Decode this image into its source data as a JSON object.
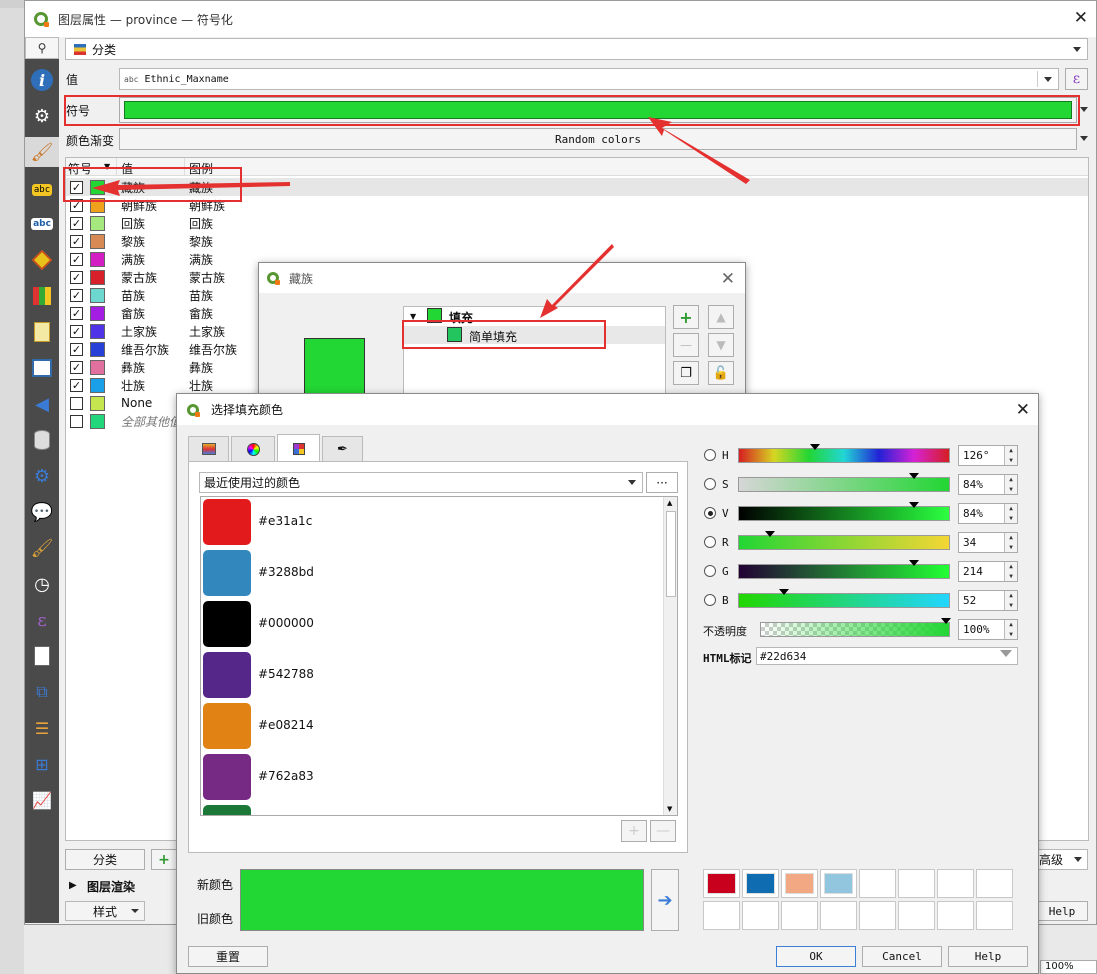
{
  "main": {
    "title": "图层属性 — province — 符号化",
    "renderer": "分类",
    "value_label": "值",
    "value_field_type": "abc",
    "value_field": "Ethnic_Maxname",
    "symbol_label": "符号",
    "ramp_label": "颜色渐变",
    "ramp_value": "Random colors",
    "headers": [
      "符号",
      "值",
      "图例"
    ],
    "rows": [
      {
        "checked": true,
        "color": "#22d634",
        "value": "藏族",
        "legend": "藏族"
      },
      {
        "checked": true,
        "color": "#f0a21c",
        "value": "朝鲜族",
        "legend": "朝鲜族"
      },
      {
        "checked": true,
        "color": "#a4e87e",
        "value": "回族",
        "legend": "回族"
      },
      {
        "checked": true,
        "color": "#d88a54",
        "value": "黎族",
        "legend": "黎族"
      },
      {
        "checked": true,
        "color": "#d21ec2",
        "value": "满族",
        "legend": "满族"
      },
      {
        "checked": true,
        "color": "#d8202a",
        "value": "蒙古族",
        "legend": "蒙古族"
      },
      {
        "checked": true,
        "color": "#6cd8cf",
        "value": "苗族",
        "legend": "苗族"
      },
      {
        "checked": true,
        "color": "#a31ee2",
        "value": "畲族",
        "legend": "畲族"
      },
      {
        "checked": true,
        "color": "#4f33e6",
        "value": "土家族",
        "legend": "土家族"
      },
      {
        "checked": true,
        "color": "#2640d8",
        "value": "维吾尔族",
        "legend": "维吾尔族"
      },
      {
        "checked": true,
        "color": "#e0709e",
        "value": "彝族",
        "legend": "彝族"
      },
      {
        "checked": true,
        "color": "#1aa0e8",
        "value": "壮族",
        "legend": "壮族"
      },
      {
        "checked": false,
        "color": "#c6e650",
        "value": "None",
        "legend": ""
      },
      {
        "checked": false,
        "color": "#22d67c",
        "value": "全部其他值",
        "legend": ""
      }
    ],
    "classify_button": "分类",
    "advanced_label": "高级",
    "layer_render": "图层渲染",
    "style_button": "样式",
    "help_button": "Help",
    "status_zoom": "100%"
  },
  "symbol_dialog": {
    "title": "藏族",
    "tree_fill": "填充",
    "tree_simple_fill": "简单填充"
  },
  "color_dialog": {
    "title": "选择填充颜色",
    "tabs": [
      "color-ramp-tab",
      "color-wheel-tab",
      "swatches-tab",
      "color-picker-tab"
    ],
    "recent_label": "最近使用过的颜色",
    "more_button": "···",
    "recent_colors": [
      {
        "hex": "#e31a1c",
        "label": "#e31a1c"
      },
      {
        "hex": "#3288bd",
        "label": "#3288bd"
      },
      {
        "hex": "#000000",
        "label": "#000000"
      },
      {
        "hex": "#542788",
        "label": "#542788"
      },
      {
        "hex": "#e08214",
        "label": "#e08214"
      },
      {
        "hex": "#762a83",
        "label": "#762a83"
      },
      {
        "hex": "#1b7837",
        "label": ""
      }
    ],
    "channels": [
      {
        "key": "H",
        "value": "126°",
        "fraction": 0.35,
        "selected": false
      },
      {
        "key": "S",
        "value": "84%",
        "fraction": 0.84,
        "selected": false
      },
      {
        "key": "V",
        "value": "84%",
        "fraction": 0.84,
        "selected": true
      },
      {
        "key": "R",
        "value": "34",
        "fraction": 0.13,
        "selected": false
      },
      {
        "key": "G",
        "value": "214",
        "fraction": 0.84,
        "selected": false
      },
      {
        "key": "B",
        "value": "52",
        "fraction": 0.2,
        "selected": false
      }
    ],
    "opacity_label": "不透明度",
    "opacity_value": "100%",
    "opacity_fraction": 1.0,
    "html_label": "HTML标记",
    "html_value": "#22d634",
    "new_color_label": "新颜色",
    "old_color_label": "旧颜色",
    "current_color": "#22d634",
    "palette_swatches": [
      "#c8001e",
      "#0f6cb0",
      "#f2a882",
      "#92c5de",
      "",
      "",
      "",
      "",
      "",
      "",
      "",
      "",
      "",
      "",
      "",
      ""
    ],
    "reset_button": "重置",
    "ok_button": "OK",
    "cancel_button": "Cancel",
    "help_button": "Help"
  },
  "colors": {
    "accent_red": "#e53030",
    "symbol_green": "#22d634"
  }
}
